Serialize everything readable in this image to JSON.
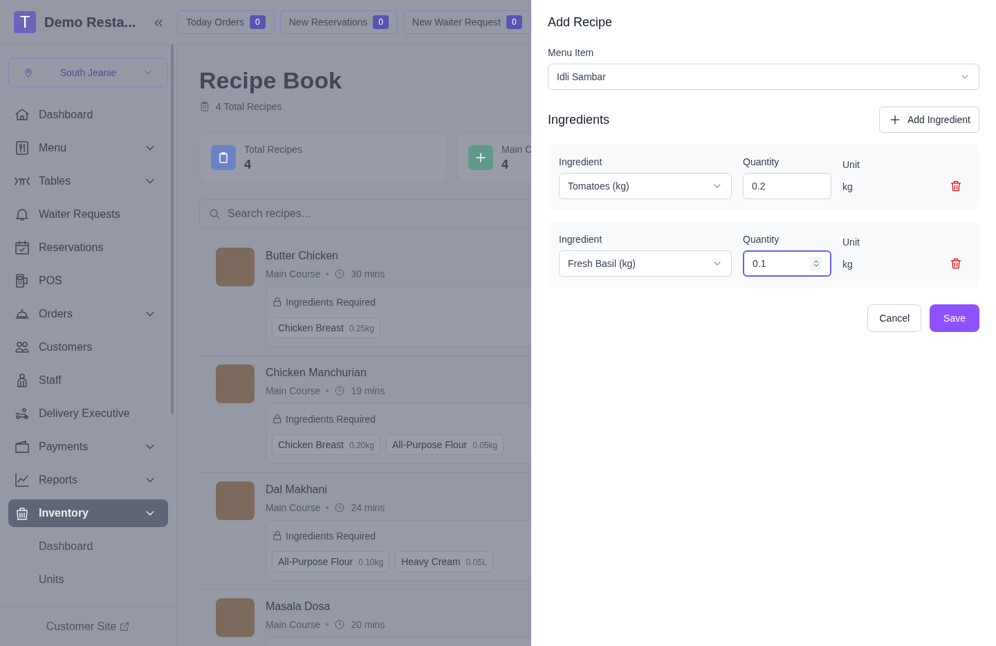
{
  "header": {
    "brand_initial": "T",
    "brand_name": "Demo Resta...",
    "collapse_icon": "«",
    "counters": [
      {
        "label": "Today Orders",
        "count": "0"
      },
      {
        "label": "New Reservations",
        "count": "0"
      },
      {
        "label": "New Waiter Request",
        "count": "0"
      }
    ]
  },
  "branch_selector": {
    "value": "South Jeanie"
  },
  "sidebar": {
    "items": [
      {
        "label": "Dashboard",
        "has_submenu": false,
        "selected": false
      },
      {
        "label": "Menu",
        "has_submenu": true,
        "selected": false
      },
      {
        "label": "Tables",
        "has_submenu": true,
        "selected": false
      },
      {
        "label": "Waiter Requests",
        "has_submenu": false,
        "selected": false
      },
      {
        "label": "Reservations",
        "has_submenu": false,
        "selected": false
      },
      {
        "label": "POS",
        "has_submenu": false,
        "selected": false
      },
      {
        "label": "Orders",
        "has_submenu": true,
        "selected": false
      },
      {
        "label": "Customers",
        "has_submenu": false,
        "selected": false
      },
      {
        "label": "Staff",
        "has_submenu": false,
        "selected": false
      },
      {
        "label": "Delivery Executive",
        "has_submenu": false,
        "selected": false
      },
      {
        "label": "Payments",
        "has_submenu": true,
        "selected": false
      },
      {
        "label": "Reports",
        "has_submenu": true,
        "selected": false
      },
      {
        "label": "Inventory",
        "has_submenu": true,
        "selected": true,
        "children": [
          {
            "label": "Dashboard"
          },
          {
            "label": "Units"
          }
        ]
      }
    ],
    "footer_link": "Customer Site"
  },
  "page": {
    "title": "Recipe Book",
    "subtitle": "4 Total Recipes",
    "stats": [
      {
        "label": "Total Recipes",
        "value": "4",
        "color": "#6b83c6"
      },
      {
        "label": "Main C",
        "value": "4",
        "color": "#5e9a8a"
      }
    ],
    "search": {
      "placeholder": "Search recipes..."
    },
    "recipes": [
      {
        "name": "Butter Chicken",
        "category": "Main Course",
        "time": "30 mins",
        "ingredients_title": "Ingredients Required",
        "ingredients": [
          {
            "name": "Chicken Breast",
            "amount": "0.25kg"
          }
        ]
      },
      {
        "name": "Chicken Manchurian",
        "category": "Main Course",
        "time": "19 mins",
        "ingredients_title": "Ingredients Required",
        "ingredients": [
          {
            "name": "Chicken Breast",
            "amount": "0.20kg"
          },
          {
            "name": "All-Purpose Flour",
            "amount": "0.05kg"
          }
        ]
      },
      {
        "name": "Dal Makhani",
        "category": "Main Course",
        "time": "24 mins",
        "ingredients_title": "Ingredients Required",
        "ingredients": [
          {
            "name": "All-Purpose Flour",
            "amount": "0.10kg"
          },
          {
            "name": "Heavy Cream",
            "amount": "0.05L"
          }
        ]
      },
      {
        "name": "Masala Dosa",
        "category": "Main Course",
        "time": "20 mins"
      }
    ]
  },
  "drawer": {
    "title": "Add Recipe",
    "menu_item_label": "Menu Item",
    "menu_item_value": "Idli Sambar",
    "ingredients_heading": "Ingredients",
    "add_button": "Add Ingredient",
    "rows": [
      {
        "ingredient_label": "Ingredient",
        "ingredient": "Tomatoes (kg)",
        "quantity_label": "Quantity",
        "quantity": "0.2",
        "unit_label": "Unit",
        "unit": "kg",
        "focused": false
      },
      {
        "ingredient_label": "Ingredient",
        "ingredient": "Fresh Basil (kg)",
        "quantity_label": "Quantity",
        "quantity": "0.1",
        "unit_label": "Unit",
        "unit": "kg",
        "focused": true
      }
    ],
    "cancel": "Cancel",
    "save": "Save"
  }
}
